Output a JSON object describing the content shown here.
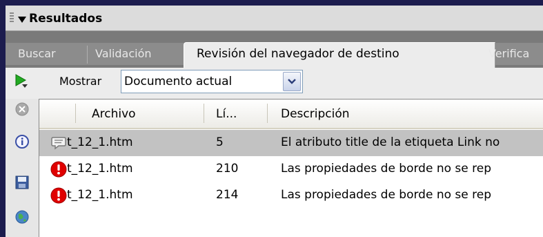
{
  "panel": {
    "title": "Resultados"
  },
  "tabs": [
    {
      "label": "Buscar"
    },
    {
      "label": "Validación"
    },
    {
      "label": "Revisión del navegador de destino",
      "active": true
    },
    {
      "label": "Verifica"
    }
  ],
  "toolbar": {
    "show_label": "Mostrar",
    "select_value": "Documento actual"
  },
  "table": {
    "columns": [
      "Archivo",
      "Lí...",
      "Descripción"
    ],
    "rows": [
      {
        "icon": "comment-icon",
        "file": "t_12_1.htm",
        "line": "5",
        "description": "El atributo title de la etiqueta Link no",
        "selected": true
      },
      {
        "icon": "error-icon",
        "file": "t_12_1.htm",
        "line": "210",
        "description": "Las propiedades de borde no se rep"
      },
      {
        "icon": "error-icon",
        "file": "t_12_1.htm",
        "line": "214",
        "description": "Las propiedades de borde no se rep"
      }
    ]
  },
  "side_icons": [
    "stop-icon",
    "info-icon",
    "save-icon",
    "globe-icon"
  ],
  "colors": {
    "outer_background": "#1c1c4e",
    "tab_bar": "#8c8c8c",
    "selected_row": "#c2c2c2",
    "error_red": "#e00000",
    "run_green": "#22aa22"
  }
}
